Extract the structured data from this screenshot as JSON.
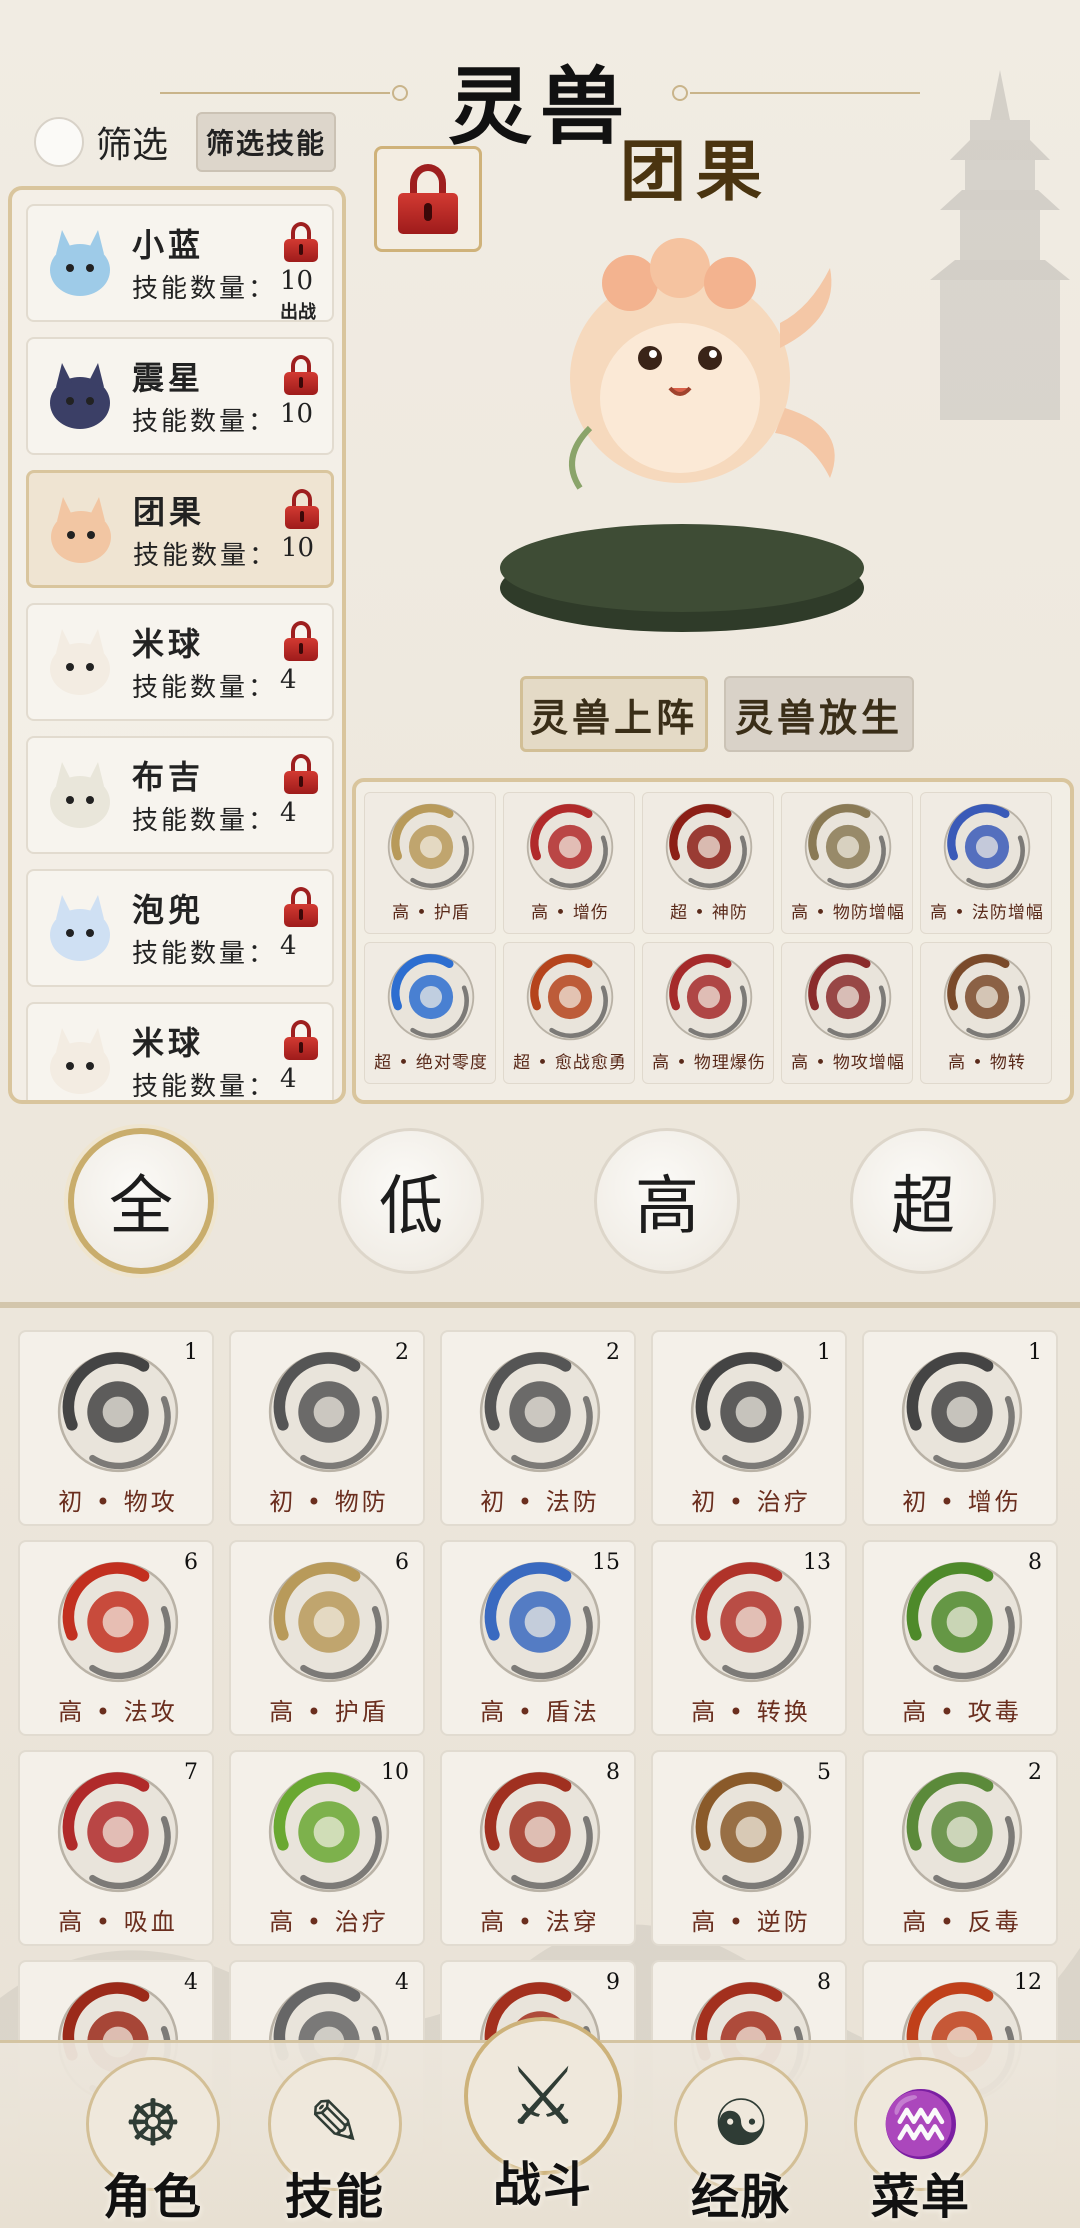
{
  "header": {
    "title": "灵兽",
    "selected_beast_name": "团果"
  },
  "filter": {
    "label": "筛选",
    "button_label": "筛选技能"
  },
  "beasts": [
    {
      "name": "小蓝",
      "skill_label": "技能数量：",
      "skill_count": "10",
      "tag": "出战",
      "color": "#9ecbe8"
    },
    {
      "name": "震星",
      "skill_label": "技能数量：",
      "skill_count": "10",
      "tag": "",
      "color": "#3b3f66"
    },
    {
      "name": "团果",
      "skill_label": "技能数量：",
      "skill_count": "10",
      "tag": "",
      "color": "#f2c6a3"
    },
    {
      "name": "米球",
      "skill_label": "技能数量：",
      "skill_count": "4",
      "tag": "",
      "color": "#f3ece2"
    },
    {
      "name": "布吉",
      "skill_label": "技能数量：",
      "skill_count": "4",
      "tag": "",
      "color": "#e9e6da"
    },
    {
      "name": "泡兜",
      "skill_label": "技能数量：",
      "skill_count": "4",
      "tag": "",
      "color": "#cfe0f3"
    },
    {
      "name": "米球",
      "skill_label": "技能数量：",
      "skill_count": "4",
      "tag": "",
      "color": "#f3ece2"
    }
  ],
  "actions": {
    "deploy": "灵兽上阵",
    "release": "灵兽放生"
  },
  "equipped_skills": [
    {
      "label": "高 • 护盾",
      "icon": "shield-icon",
      "color": "#b89a5a"
    },
    {
      "label": "高 • 增伤",
      "icon": "arrow-up-icon",
      "color": "#b12a2a"
    },
    {
      "label": "超 • 神防",
      "icon": "divine-shield-icon",
      "color": "#8c1f16"
    },
    {
      "label": "高 • 物防增幅",
      "icon": "shield-boost-icon",
      "color": "#8a7a55"
    },
    {
      "label": "高 • 法防增幅",
      "icon": "magic-shield-icon",
      "color": "#3a5ab8"
    },
    {
      "label": "超 • 绝对零度",
      "icon": "snowflake-icon",
      "color": "#2d6ed0"
    },
    {
      "label": "超 • 愈战愈勇",
      "icon": "flame-crest-icon",
      "color": "#b5441c"
    },
    {
      "label": "高 • 物理爆伤",
      "icon": "blade-burst-icon",
      "color": "#a52a2a"
    },
    {
      "label": "高 • 物攻增幅",
      "icon": "swords-icon",
      "color": "#8a2b2b"
    },
    {
      "label": "高 • 物转",
      "icon": "sword-shield-icon",
      "color": "#7a4a2a"
    }
  ],
  "tiers": [
    "全",
    "低",
    "高",
    "超"
  ],
  "inventory": [
    {
      "count": "1",
      "label": "初 • 物攻",
      "icon": "sword-icon",
      "color": "#444444"
    },
    {
      "count": "2",
      "label": "初 • 物防",
      "icon": "shield-icon",
      "color": "#555555"
    },
    {
      "count": "2",
      "label": "初 • 法防",
      "icon": "hex-shield-icon",
      "color": "#555555"
    },
    {
      "count": "1",
      "label": "初 • 治疗",
      "icon": "heart-icon",
      "color": "#444444"
    },
    {
      "count": "1",
      "label": "初 • 增伤",
      "icon": "arrow-up-icon",
      "color": "#444444"
    },
    {
      "count": "6",
      "label": "高 • 法攻",
      "icon": "fire-orb-icon",
      "color": "#c23020"
    },
    {
      "count": "6",
      "label": "高 • 护盾",
      "icon": "shield-icon",
      "color": "#b89a5a"
    },
    {
      "count": "15",
      "label": "高 • 盾法",
      "icon": "magic-shield-icon",
      "color": "#3a6ac0"
    },
    {
      "count": "13",
      "label": "高 • 转换",
      "icon": "swap-icon",
      "color": "#b0332a"
    },
    {
      "count": "8",
      "label": "高 • 攻毒",
      "icon": "poison-claw-icon",
      "color": "#4e8a2a"
    },
    {
      "count": "7",
      "label": "高 • 吸血",
      "icon": "paw-fang-icon",
      "color": "#b02a2a"
    },
    {
      "count": "10",
      "label": "高 • 治疗",
      "icon": "heart-icon",
      "color": "#6aa832"
    },
    {
      "count": "8",
      "label": "高 • 法穿",
      "icon": "pierce-icon",
      "color": "#a03020"
    },
    {
      "count": "5",
      "label": "高 • 逆防",
      "icon": "reverse-shield-icon",
      "color": "#8a5a2a"
    },
    {
      "count": "2",
      "label": "高 • 反毒",
      "icon": "poison-reflect-icon",
      "color": "#5b8a3a"
    },
    {
      "count": "4",
      "label": "",
      "icon": "sun-burst-icon",
      "color": "#9b2a1a"
    },
    {
      "count": "4",
      "label": "",
      "icon": "slash-icon",
      "color": "#666666"
    },
    {
      "count": "9",
      "label": "",
      "icon": "ring-icon",
      "color": "#a3301e"
    },
    {
      "count": "8",
      "label": "",
      "icon": "ring-icon",
      "color": "#a3301e"
    },
    {
      "count": "12",
      "label": "",
      "icon": "flame-icon",
      "color": "#c0401a"
    }
  ],
  "nav": [
    {
      "label": "角色",
      "icon": "meditating-figure-icon"
    },
    {
      "label": "技能",
      "icon": "scroll-icon"
    },
    {
      "label": "战斗",
      "icon": "crossed-swords-icon"
    },
    {
      "label": "经脉",
      "icon": "meridian-figure-icon"
    },
    {
      "label": "菜单",
      "icon": "fan-icon"
    }
  ]
}
